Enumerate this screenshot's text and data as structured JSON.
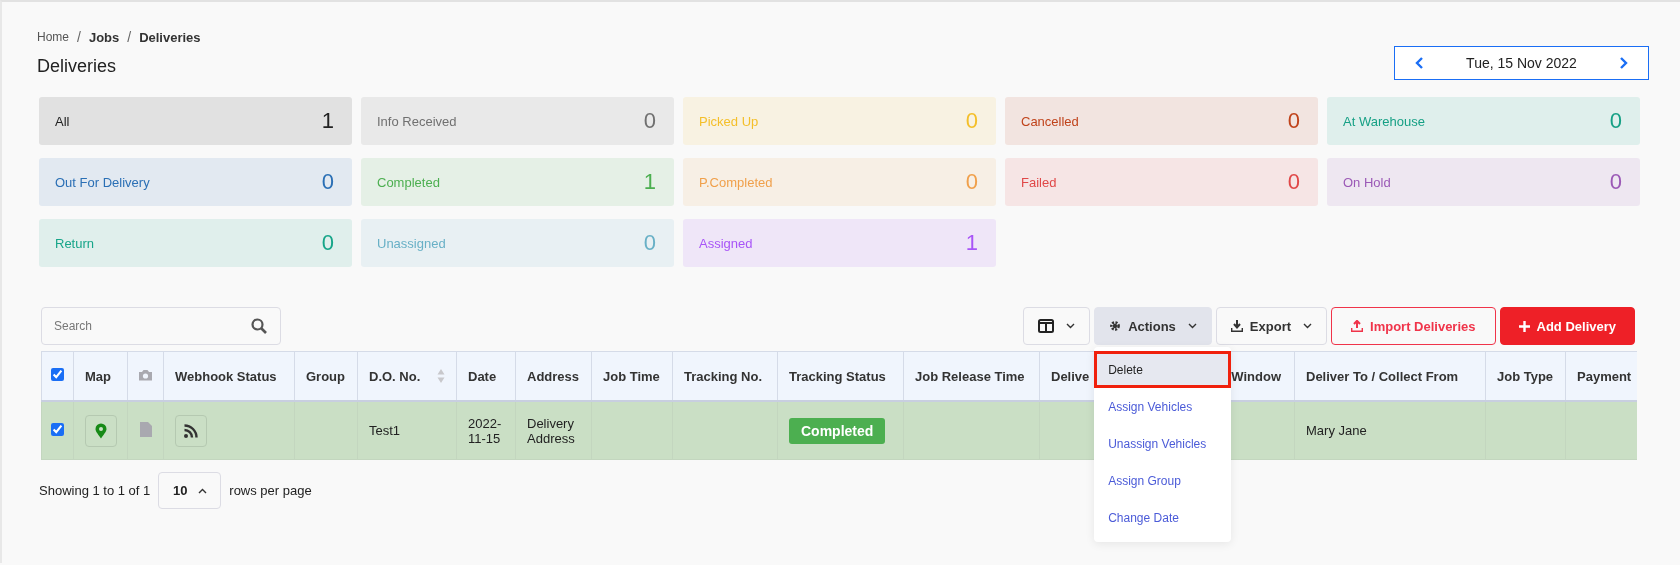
{
  "breadcrumb": [
    {
      "label": "Home",
      "bold": false
    },
    {
      "label": "Jobs",
      "bold": true,
      "separator": "/"
    },
    {
      "label": "Deliveries",
      "bold": true,
      "separator": "/"
    }
  ],
  "page_title": "Deliveries",
  "date_picker": {
    "value": "Tue, 15 Nov 2022"
  },
  "status_cards": [
    {
      "label": "All",
      "count": "1",
      "color": "#222222"
    },
    {
      "label": "Info Received",
      "count": "0",
      "color": "#707070"
    },
    {
      "label": "Picked Up",
      "count": "0",
      "color": "#f4bf2a"
    },
    {
      "label": "Cancelled",
      "count": "0",
      "color": "#c0431b"
    },
    {
      "label": "At Warehouse",
      "count": "0",
      "color": "#16a085"
    },
    {
      "label": "Out For Delivery",
      "count": "0",
      "color": "#2a6fb5"
    },
    {
      "label": "Completed",
      "count": "1",
      "color": "#4caf50"
    },
    {
      "label": "P.Completed",
      "count": "0",
      "color": "#f0a04b"
    },
    {
      "label": "Failed",
      "count": "0",
      "color": "#e04848"
    },
    {
      "label": "On Hold",
      "count": "0",
      "color": "#9b59b6"
    },
    {
      "label": "Return",
      "count": "0",
      "color": "#17a589"
    },
    {
      "label": "Unassigned",
      "count": "0",
      "color": "#68b0c6"
    },
    {
      "label": "Assigned",
      "count": "1",
      "color": "#a855f7"
    }
  ],
  "search": {
    "placeholder": "Search"
  },
  "toolbar": {
    "actions": "Actions",
    "export": "Export",
    "import": "Import Deliveries",
    "add": "Add Delivery"
  },
  "actions_menu": [
    {
      "label": "Delete",
      "selected": true
    },
    {
      "label": "Assign Vehicles",
      "selected": false
    },
    {
      "label": "Unassign Vehicles",
      "selected": false
    },
    {
      "label": "Assign Group",
      "selected": false
    },
    {
      "label": "Change Date",
      "selected": false
    }
  ],
  "table": {
    "header_checked": true,
    "columns": [
      {
        "kind": "check"
      },
      {
        "kind": "text",
        "label": "Map"
      },
      {
        "kind": "camera"
      },
      {
        "kind": "text",
        "label": "Webhook Status"
      },
      {
        "kind": "text",
        "label": "Group"
      },
      {
        "kind": "sort",
        "label": "D.O. No."
      },
      {
        "kind": "text",
        "label": "Date"
      },
      {
        "kind": "text",
        "label": "Address"
      },
      {
        "kind": "text",
        "label": "Job Time"
      },
      {
        "kind": "text",
        "label": "Tracking No."
      },
      {
        "kind": "text",
        "label": "Tracking Status"
      },
      {
        "kind": "text",
        "label": "Job Release Time"
      },
      {
        "kind": "split",
        "label": "Delive",
        "label_end": "Window"
      },
      {
        "kind": "text",
        "label": "Deliver To / Collect From"
      },
      {
        "kind": "text",
        "label": "Job Type"
      },
      {
        "kind": "text",
        "label": "Payment"
      }
    ],
    "rows": [
      {
        "checked": true,
        "do_no": "Test1",
        "date": "2022-11-15",
        "address": "Delivery Address",
        "tracking_status": "Completed",
        "deliver_to": "Mary Jane"
      }
    ]
  },
  "pagination": {
    "summary": "Showing 1 to 1 of 1",
    "page_size": "10",
    "suffix": "rows per page"
  }
}
